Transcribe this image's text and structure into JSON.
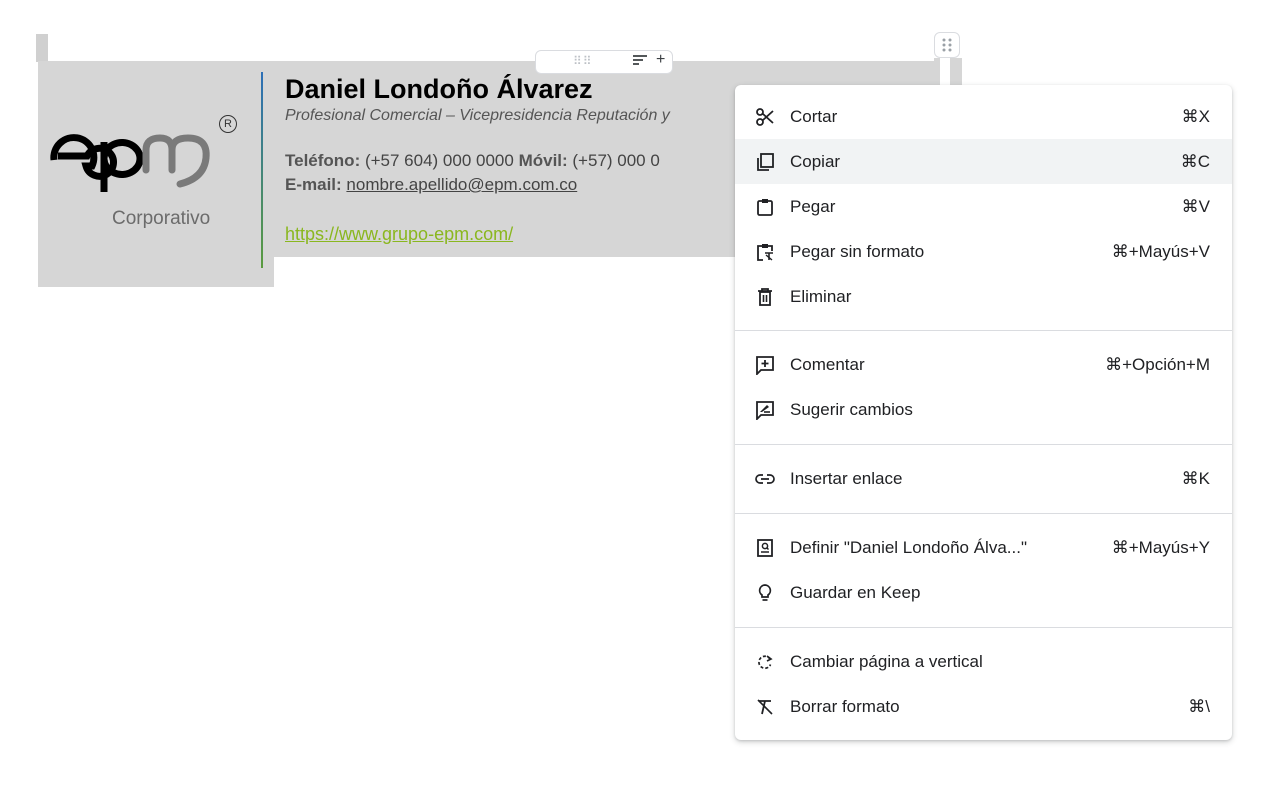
{
  "signature": {
    "logo_text": "epm",
    "registered_mark": "®",
    "logo_subtitle": "Corporativo",
    "name": "Daniel Londoño Álvarez",
    "role": "Profesional Comercial – Vicepresidencia Reputación y",
    "phone_label": "Teléfono:",
    "phone_value": " (+57 604) 000 0000  ",
    "mobile_label": "Móvil:",
    "mobile_value": " (+57) 000 0",
    "email_label": "E-mail:",
    "email_value": "nombre.apellido@epm.com.co",
    "website": "https://www.grupo-epm.com/"
  },
  "context_menu": {
    "items": [
      {
        "label": "Cortar",
        "shortcut": "⌘X",
        "icon": "scissors-icon"
      },
      {
        "label": "Copiar",
        "shortcut": "⌘C",
        "icon": "copy-icon"
      },
      {
        "label": "Pegar",
        "shortcut": "⌘V",
        "icon": "clipboard-icon"
      },
      {
        "label": "Pegar sin formato",
        "shortcut": "⌘+Mayús+V",
        "icon": "paste-plain-icon"
      },
      {
        "label": "Eliminar",
        "shortcut": "",
        "icon": "trash-icon"
      },
      {
        "label": "Comentar",
        "shortcut": "⌘+Opción+M",
        "icon": "add-comment-icon"
      },
      {
        "label": "Sugerir cambios",
        "shortcut": "",
        "icon": "suggest-edit-icon"
      },
      {
        "label": "Insertar enlace",
        "shortcut": "⌘K",
        "icon": "link-icon"
      },
      {
        "label": "Definir \"Daniel Londoño Álva...\"",
        "shortcut": "⌘+Mayús+Y",
        "icon": "dictionary-icon"
      },
      {
        "label": "Guardar en Keep",
        "shortcut": "",
        "icon": "lightbulb-icon"
      },
      {
        "label": "Cambiar página a vertical",
        "shortcut": "",
        "icon": "rotate-icon"
      },
      {
        "label": "Borrar formato",
        "shortcut": "⌘\\",
        "icon": "clear-format-icon"
      }
    ]
  },
  "colors": {
    "link_green": "#8ab71f",
    "menu_highlight": "#f1f3f4"
  }
}
